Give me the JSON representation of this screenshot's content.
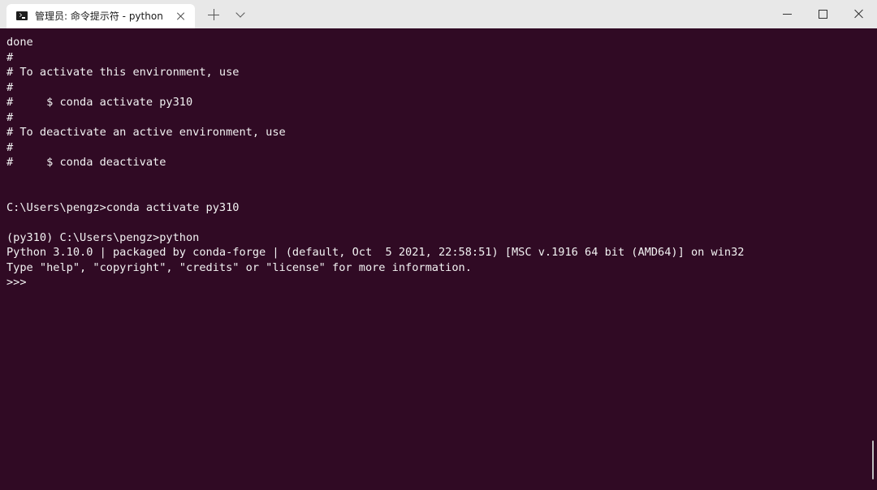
{
  "window": {
    "tab_title": "管理员: 命令提示符 - python"
  },
  "icons": {
    "tab": "terminal-icon",
    "close_tab": "close-icon",
    "new_tab": "plus-icon",
    "dropdown": "chevron-down-icon",
    "minimize": "minimize-icon",
    "maximize": "maximize-icon",
    "close_window": "close-icon"
  },
  "colors": {
    "terminal_bg": "#300a24",
    "terminal_fg": "#f2f2f2",
    "titlebar_bg": "#e8e8e8"
  },
  "terminal": {
    "lines": [
      "done",
      "#",
      "# To activate this environment, use",
      "#",
      "#     $ conda activate py310",
      "#",
      "# To deactivate an active environment, use",
      "#",
      "#     $ conda deactivate",
      "",
      "",
      "C:\\Users\\pengz>conda activate py310",
      "",
      "(py310) C:\\Users\\pengz>python",
      "Python 3.10.0 | packaged by conda-forge | (default, Oct  5 2021, 22:58:51) [MSC v.1916 64 bit (AMD64)] on win32",
      "Type \"help\", \"copyright\", \"credits\" or \"license\" for more information.",
      ">>>"
    ]
  }
}
